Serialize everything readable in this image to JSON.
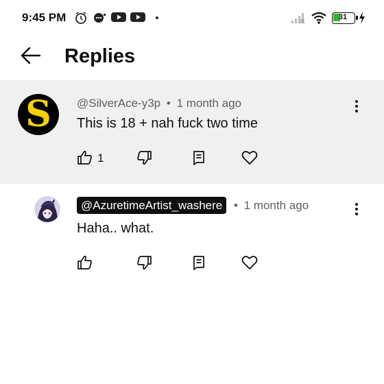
{
  "status_bar": {
    "time": "9:45 PM",
    "battery": "31"
  },
  "header": {
    "title": "Replies"
  },
  "comments": [
    {
      "handle": "@SilverAce-y3p",
      "separator": "•",
      "time_ago": "1 month ago",
      "text": "This is 18 + nah fuck two time",
      "avatar_letter": "S",
      "like_count": "1"
    },
    {
      "handle": "@AzuretimeArtist_washere",
      "separator": "•",
      "time_ago": "1 month ago",
      "text": "Haha.. what.",
      "like_count": ""
    }
  ],
  "icons": {
    "back": "arrow-left-icon",
    "like": "thumbs-up-icon",
    "dislike": "thumbs-down-icon",
    "reply": "reply-comment-icon",
    "heart": "heart-icon",
    "more": "vertical-dots-icon"
  },
  "colors": {
    "highlight_bg": "#f0f0f0",
    "avatar_letter": "#f5d100",
    "meta_text": "#606060",
    "badge_bg": "#0f0f0f"
  }
}
